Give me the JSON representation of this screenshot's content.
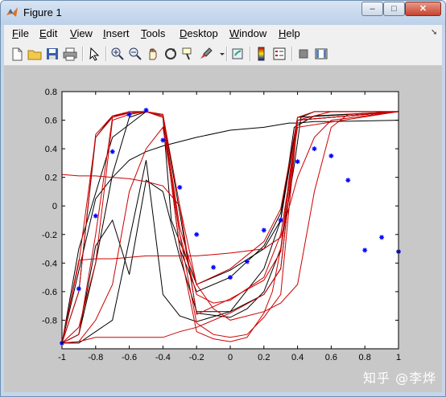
{
  "window": {
    "title": "Figure 1",
    "close_label": "✕",
    "min_label": "–",
    "max_label": "□"
  },
  "menu": [
    {
      "label": "File",
      "key": "F",
      "rest": "ile"
    },
    {
      "label": "Edit",
      "key": "E",
      "rest": "dit"
    },
    {
      "label": "View",
      "key": "V",
      "rest": "iew"
    },
    {
      "label": "Insert",
      "key": "I",
      "rest": "nsert"
    },
    {
      "label": "Tools",
      "key": "T",
      "rest": "ools"
    },
    {
      "label": "Desktop",
      "key": "D",
      "rest": "esktop"
    },
    {
      "label": "Window",
      "key": "W",
      "rest": "indow"
    },
    {
      "label": "Help",
      "key": "H",
      "rest": "elp"
    }
  ],
  "toolbar": [
    "new-figure-icon",
    "open-file-icon",
    "save-icon",
    "print-icon",
    "pointer-icon",
    "zoom-in-icon",
    "zoom-out-icon",
    "pan-hand-icon",
    "rotate-3d-icon",
    "data-cursor-icon",
    "brush-icon",
    "link-plot-icon",
    "colorbar-icon",
    "legend-icon",
    "hide-plot-tools-icon",
    "show-plot-tools-icon"
  ],
  "watermark": "知乎 @李烨",
  "colors": {
    "series_black": "#000000",
    "series_red": "#cc0000",
    "markers": "#0000ff",
    "figure_bg": "#c8c8c8"
  },
  "chart_data": {
    "type": "line",
    "title": "",
    "xlabel": "",
    "ylabel": "",
    "xlim": [
      -1,
      1
    ],
    "ylim": [
      -1,
      0.8
    ],
    "xticks": [
      "-1",
      "-0.8",
      "-0.6",
      "-0.4",
      "-0.2",
      "0",
      "0.2",
      "0.4",
      "0.6",
      "0.8",
      "1"
    ],
    "yticks": [
      "-0.8",
      "-0.6",
      "-0.4",
      "-0.2",
      "0",
      "0.2",
      "0.4",
      "0.6",
      "0.8"
    ],
    "grid": false,
    "samples": {
      "marker": "*",
      "x": [
        -1.0,
        -0.9,
        -0.8,
        -0.7,
        -0.6,
        -0.5,
        -0.4,
        -0.3,
        -0.2,
        -0.1,
        0.0,
        0.1,
        0.2,
        0.3,
        0.4,
        0.5,
        0.6,
        0.7,
        0.8,
        0.9,
        1.0
      ],
      "y": [
        -0.96,
        -0.58,
        -0.07,
        0.38,
        0.64,
        0.67,
        0.46,
        0.13,
        -0.2,
        -0.43,
        -0.5,
        -0.39,
        -0.17,
        -0.1,
        0.31,
        0.4,
        0.35,
        0.18,
        -0.31,
        -0.22,
        -0.32
      ]
    },
    "series": [
      {
        "color": "black",
        "x": [
          -1,
          -0.9,
          -0.7,
          -0.5,
          -0.4,
          -0.3,
          -0.2,
          0,
          0.2,
          0.3,
          0.4,
          1
        ],
        "y": [
          -0.96,
          -0.96,
          -0.8,
          0.32,
          -0.62,
          -0.77,
          -0.81,
          -0.74,
          -0.62,
          -0.44,
          0.6,
          0.66
        ]
      },
      {
        "color": "black",
        "x": [
          -1,
          -0.9,
          -0.8,
          -0.7,
          -0.6,
          -0.5,
          -0.4,
          -0.3,
          -0.2,
          0,
          0.2,
          0.3,
          0.4,
          1
        ],
        "y": [
          -0.96,
          -0.9,
          -0.28,
          -0.1,
          -0.48,
          0.18,
          0.1,
          -0.36,
          -0.74,
          -0.74,
          -0.44,
          -0.1,
          0.62,
          0.66
        ]
      },
      {
        "color": "black",
        "x": [
          -1,
          -0.9,
          -0.8,
          -0.7,
          -0.6,
          -0.5,
          -0.4,
          -0.3,
          -0.2,
          0,
          0.2,
          0.3,
          0.4,
          1
        ],
        "y": [
          -0.96,
          -0.6,
          0.48,
          0.63,
          0.65,
          0.66,
          0.63,
          -0.3,
          -0.6,
          -0.5,
          -0.28,
          -0.05,
          0.6,
          0.66
        ]
      },
      {
        "color": "black",
        "x": [
          -1,
          -0.9,
          -0.8,
          -0.7,
          -0.6,
          -0.5,
          -0.4,
          -0.35,
          -0.2,
          0,
          0.2,
          0.3,
          0.38,
          0.5,
          1
        ],
        "y": [
          -0.96,
          -0.9,
          -0.4,
          0.22,
          0.62,
          0.66,
          0.62,
          -0.1,
          -0.55,
          -0.45,
          -0.3,
          -0.1,
          0.55,
          0.63,
          0.66
        ]
      },
      {
        "color": "black",
        "x": [
          -1,
          -0.8,
          -0.7,
          -0.6,
          -0.5,
          -0.4,
          -0.2,
          0,
          0.2,
          0.3,
          0.35,
          0.4,
          0.5,
          0.6,
          1
        ],
        "y": [
          -0.96,
          0.05,
          0.2,
          0.32,
          0.38,
          0.42,
          0.48,
          0.53,
          0.55,
          0.57,
          0.58,
          0.58,
          0.59,
          0.59,
          0.6
        ]
      },
      {
        "color": "black",
        "x": [
          -1,
          -0.9,
          -0.7,
          -0.5,
          -0.4,
          -0.3,
          -0.2,
          0,
          0.1,
          0.2,
          0.3,
          0.38,
          0.42,
          0.5,
          1
        ],
        "y": [
          -0.96,
          -0.3,
          0.48,
          0.66,
          0.64,
          -0.05,
          -0.75,
          -0.78,
          -0.72,
          -0.6,
          -0.3,
          0.28,
          0.62,
          0.66,
          0.66
        ]
      },
      {
        "color": "red",
        "x": [
          -1,
          -0.9,
          -0.8,
          -0.7,
          -0.6,
          -0.5,
          -0.4,
          -0.3,
          -0.2,
          0,
          0.2,
          0.3,
          0.4,
          1
        ],
        "y": [
          -0.96,
          -0.95,
          -0.92,
          -0.92,
          -0.92,
          -0.92,
          -0.92,
          -0.88,
          -0.85,
          -0.75,
          -0.62,
          -0.44,
          0.6,
          0.66
        ]
      },
      {
        "color": "red",
        "x": [
          -1,
          -0.9,
          -0.8,
          -0.7,
          -0.6,
          -0.5,
          -0.4,
          -0.3,
          -0.2,
          0,
          0.2,
          0.3,
          0.4,
          0.5,
          1
        ],
        "y": [
          -0.96,
          -0.4,
          0.48,
          0.62,
          0.65,
          0.66,
          0.63,
          -0.15,
          -0.55,
          -0.44,
          -0.25,
          -0.02,
          0.62,
          0.66,
          0.66
        ]
      },
      {
        "color": "red",
        "x": [
          -1,
          -0.9,
          -0.8,
          -0.7,
          -0.6,
          -0.5,
          -0.4,
          -0.3,
          -0.2,
          -0.1,
          0,
          0.2,
          0.3,
          0.4,
          1
        ],
        "y": [
          -0.96,
          -0.6,
          0.5,
          0.63,
          0.66,
          0.66,
          0.64,
          -0.2,
          -0.62,
          -0.68,
          -0.66,
          -0.5,
          -0.2,
          0.55,
          0.66
        ]
      },
      {
        "color": "red",
        "x": [
          -1,
          -0.9,
          -0.8,
          -0.7,
          -0.6,
          -0.5,
          -0.4,
          -0.3,
          -0.2,
          -0.1,
          0,
          0.2,
          0.3,
          0.4,
          0.5,
          0.6,
          1
        ],
        "y": [
          -0.96,
          -0.38,
          -0.37,
          -0.37,
          -0.36,
          -0.35,
          -0.35,
          -0.35,
          -0.35,
          -0.34,
          -0.33,
          -0.3,
          -0.22,
          0.2,
          0.48,
          0.6,
          0.66
        ]
      },
      {
        "color": "red",
        "x": [
          -1,
          -0.9,
          -0.8,
          -0.7,
          -0.6,
          -0.5,
          -0.4,
          -0.3,
          -0.2,
          -0.1,
          0,
          0.2,
          0.3,
          0.4,
          0.5,
          0.6,
          0.7,
          1
        ],
        "y": [
          0.22,
          0.21,
          0.21,
          0.2,
          0.19,
          0.17,
          0.14,
          0.0,
          -0.55,
          -0.72,
          -0.8,
          -0.74,
          -0.68,
          -0.55,
          0.1,
          0.55,
          0.64,
          0.66
        ]
      },
      {
        "color": "red",
        "x": [
          -1,
          -0.9,
          -0.8,
          -0.7,
          -0.6,
          -0.5,
          -0.4,
          -0.3,
          -0.2,
          -0.1,
          0,
          0.1,
          0.2,
          0.3,
          0.4,
          0.6,
          1
        ],
        "y": [
          -0.96,
          -0.95,
          -0.8,
          -0.55,
          0.1,
          0.4,
          0.55,
          -0.2,
          -0.82,
          -0.9,
          -0.92,
          -0.9,
          -0.78,
          -0.62,
          0.6,
          0.66,
          0.66
        ]
      },
      {
        "color": "red",
        "x": [
          -1,
          -0.9,
          -0.8,
          -0.7,
          -0.6,
          -0.5,
          -0.4,
          -0.3,
          -0.2,
          0,
          0.2,
          0.3,
          0.4,
          1
        ],
        "y": [
          -0.96,
          -0.85,
          -0.4,
          0.6,
          0.64,
          0.66,
          0.64,
          0.0,
          -0.76,
          -0.65,
          -0.52,
          -0.32,
          0.6,
          0.66
        ]
      },
      {
        "color": "red",
        "x": [
          -1,
          -0.9,
          -0.8,
          -0.7,
          -0.6,
          -0.5,
          -0.4,
          -0.3,
          -0.2,
          -0.1,
          0,
          0.1,
          0.2,
          0.25,
          0.3,
          0.35,
          0.4,
          1
        ],
        "y": [
          -0.96,
          -0.9,
          -0.2,
          0.62,
          0.66,
          0.66,
          0.62,
          -0.3,
          -0.88,
          -0.93,
          -0.95,
          -0.92,
          -0.75,
          -0.6,
          -0.3,
          0.2,
          0.6,
          0.66
        ]
      }
    ]
  }
}
